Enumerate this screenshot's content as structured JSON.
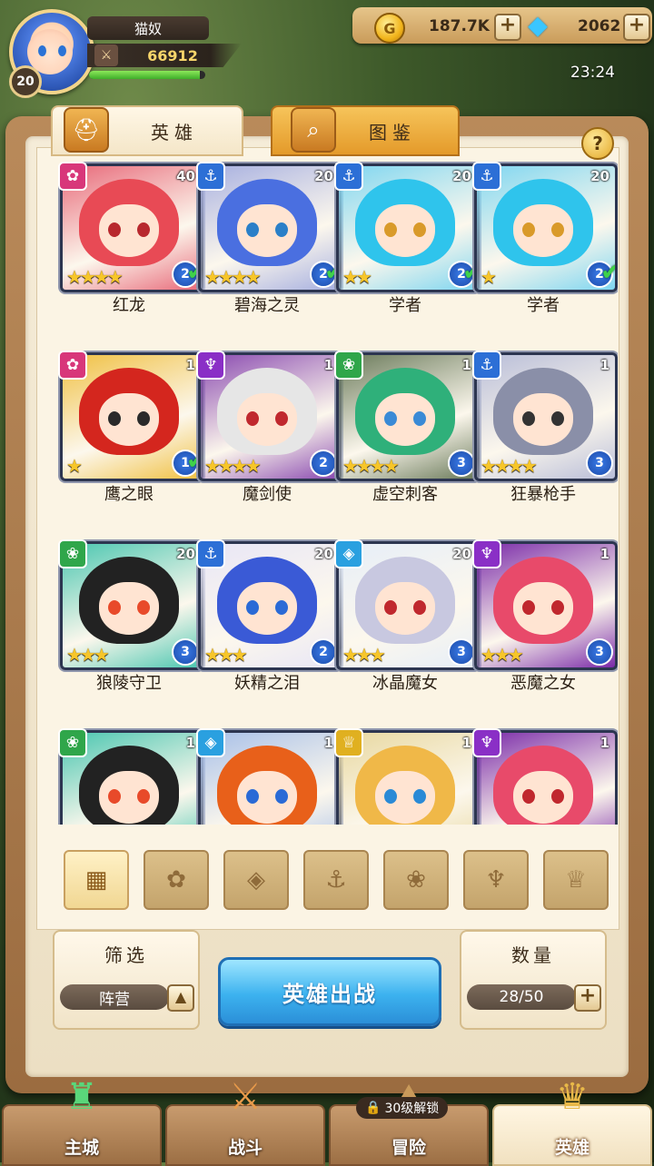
{
  "player": {
    "name": "猫奴",
    "level": "20",
    "power": "66912",
    "xp_fraction": 0.95
  },
  "resources": {
    "gold": "187.7K",
    "gems": "2062"
  },
  "clock": "23:24",
  "tabs": [
    {
      "label": "英雄"
    },
    {
      "label": "图鉴"
    }
  ],
  "help": "?",
  "heroes": [
    {
      "name": "红龙",
      "level": "40",
      "stars": 4,
      "rank": "2",
      "checked": true,
      "faction": "fire",
      "hair": "#e84a55",
      "eye": "#b8282e",
      "bg": "#e86a7a",
      "fc": "#d8377a"
    },
    {
      "name": "碧海之灵",
      "level": "20",
      "stars": 4,
      "rank": "2",
      "checked": true,
      "faction": "water",
      "hair": "#4a6fe0",
      "eye": "#2a7fc8",
      "bg": "#a7b0e0",
      "fc": "#2c6fd6"
    },
    {
      "name": "学者",
      "level": "20",
      "stars": 2,
      "rank": "2",
      "checked": true,
      "faction": "water",
      "hair": "#2fc4ec",
      "eye": "#d99a2a",
      "bg": "#7fd6f0",
      "fc": "#2c6fd6"
    },
    {
      "name": "学者",
      "level": "20",
      "stars": 1,
      "rank": "2",
      "checked": true,
      "faction": "water",
      "hair": "#2fc4ec",
      "eye": "#d99a2a",
      "bg": "#7fd6f0",
      "fc": "#2c6fd6"
    },
    {
      "name": "鹰之眼",
      "level": "1",
      "stars": 1,
      "rank": "1",
      "checked": true,
      "faction": "fire",
      "hair": "#d4261e",
      "eye": "#2a2a2a",
      "bg": "#f0c042",
      "fc": "#d8377a"
    },
    {
      "name": "魔剑使",
      "level": "1",
      "stars": 4,
      "rank": "2",
      "checked": false,
      "faction": "dark",
      "hair": "#e6e6e6",
      "eye": "#c0282e",
      "bg": "#8a4ab0",
      "fc": "#8a2fc6"
    },
    {
      "name": "虚空刺客",
      "level": "1",
      "stars": 4,
      "rank": "3",
      "checked": false,
      "faction": "nature",
      "hair": "#2fb07a",
      "eye": "#3a8ad6",
      "bg": "#6a7a5a",
      "fc": "#2fa64a"
    },
    {
      "name": "狂暴枪手",
      "level": "1",
      "stars": 4,
      "rank": "3",
      "checked": false,
      "faction": "water",
      "hair": "#8a8fa8",
      "eye": "#333333",
      "bg": "#b8bdd8",
      "fc": "#2c6fd6"
    },
    {
      "name": "狼陵守卫",
      "level": "20",
      "stars": 3,
      "rank": "3",
      "checked": false,
      "faction": "nature",
      "hair": "#222222",
      "eye": "#e84a2a",
      "bg": "#4ac6b0",
      "fc": "#2fa64a"
    },
    {
      "name": "妖精之泪",
      "level": "20",
      "stars": 3,
      "rank": "2",
      "checked": false,
      "faction": "water",
      "hair": "#3a5ad6",
      "eye": "#2a6ad6",
      "bg": "#e8e6f6",
      "fc": "#2c6fd6"
    },
    {
      "name": "冰晶魔女",
      "level": "20",
      "stars": 3,
      "rank": "3",
      "checked": false,
      "faction": "ice",
      "hair": "#c8c8e0",
      "eye": "#c0282e",
      "bg": "#e6eef8",
      "fc": "#2aa0e0"
    },
    {
      "name": "恶魔之女",
      "level": "1",
      "stars": 3,
      "rank": "3",
      "checked": false,
      "faction": "dark",
      "hair": "#e84a6a",
      "eye": "#c0282e",
      "bg": "#7a2aa8",
      "fc": "#8a2fc6"
    },
    {
      "name": "",
      "level": "1",
      "stars": 0,
      "rank": "",
      "checked": false,
      "faction": "nature",
      "hair": "#222222",
      "eye": "#e84a2a",
      "bg": "#4ac6b0",
      "fc": "#2fa64a"
    },
    {
      "name": "",
      "level": "1",
      "stars": 0,
      "rank": "",
      "checked": false,
      "faction": "ice",
      "hair": "#e8601a",
      "eye": "#2a6ad6",
      "bg": "#a8c0e8",
      "fc": "#2aa0e0"
    },
    {
      "name": "",
      "level": "1",
      "stars": 0,
      "rank": "",
      "checked": false,
      "faction": "light",
      "hair": "#f0b848",
      "eye": "#2a8ad6",
      "bg": "#e8d8a0",
      "fc": "#e0b020"
    },
    {
      "name": "",
      "level": "1",
      "stars": 0,
      "rank": "",
      "checked": false,
      "faction": "dark",
      "hair": "#e84a6a",
      "eye": "#c0282e",
      "bg": "#7a2aa8",
      "fc": "#8a2fc6"
    }
  ],
  "faction_icons": {
    "fire": "✿",
    "water": "⚓",
    "dark": "♆",
    "nature": "❀",
    "ice": "◈",
    "light": "♕"
  },
  "filters": [
    {
      "name": "all",
      "icon": "▦"
    },
    {
      "name": "fire",
      "icon": "✿"
    },
    {
      "name": "ice",
      "icon": "◈"
    },
    {
      "name": "water",
      "icon": "⚓"
    },
    {
      "name": "nature",
      "icon": "❀"
    },
    {
      "name": "dark",
      "icon": "♆"
    },
    {
      "name": "light",
      "icon": "♕"
    }
  ],
  "filter_panel": {
    "title": "筛选",
    "value": "阵营"
  },
  "deploy": "英雄出战",
  "count_panel": {
    "title": "数量",
    "value": "28/50"
  },
  "nav": [
    {
      "label": "主城",
      "icon": "♜"
    },
    {
      "label": "战斗",
      "icon": "⚔"
    },
    {
      "label": "冒险",
      "icon": "⛰",
      "lock": "30级解锁"
    },
    {
      "label": "英雄",
      "icon": "♛"
    }
  ]
}
